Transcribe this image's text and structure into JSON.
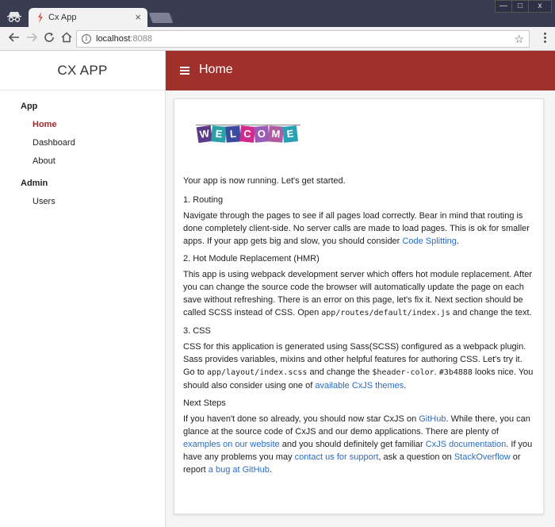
{
  "browser": {
    "tab_title": "Cx App",
    "tab_close": "×",
    "url_host": "localhost",
    "url_port": ":8088",
    "window_controls": [
      "—",
      "□",
      "x"
    ],
    "icons": [
      "incognito-icon",
      "favicon-icon",
      "back-icon",
      "forward-icon",
      "reload-icon",
      "home-icon",
      "info-icon",
      "star-icon",
      "menu-icon"
    ]
  },
  "sidebar": {
    "brand": "CX APP",
    "groups": [
      {
        "title": "App",
        "items": [
          "Home",
          "Dashboard",
          "About"
        ]
      },
      {
        "title": "Admin",
        "items": [
          "Users"
        ]
      }
    ]
  },
  "header": {
    "title": "Home"
  },
  "welcome_letters": [
    "W",
    "E",
    "L",
    "C",
    "O",
    "M",
    "E"
  ],
  "welcome_colors": [
    "#5a3a8a",
    "#2aa0a8",
    "#3a4aa0",
    "#d02a8a",
    "#9a5ab8",
    "#b05aa0",
    "#2aa0b8"
  ],
  "content": {
    "intro": "Your app is now running. Let's get started.",
    "routing": {
      "title": "1. Routing",
      "text": "Navigate through the pages to see if all pages load correctly. Bear in mind that routing is done completely client-side. No server calls are made to load pages. This is ok for smaller apps. If your app gets big and slow, you should consider ",
      "link": "Code Splitting",
      "tail": "."
    },
    "hmr": {
      "title": "2. Hot Module Replacement (HMR)",
      "text": "This app is using webpack development server which offers hot module replacement. After you can change the source code the browser will automatically update the page on each save without refreshing. There is an error on this page, let's fix it. Next section should be called SCSS instead of CSS. Open ",
      "code": "app/routes/default/index.js",
      "tail": " and change the text."
    },
    "css": {
      "title": "3. CSS",
      "text1": "CSS for this application is generated using Sass(SCSS) configured as a webpack plugin. Sass provides variables, mixins and other helpful features for authoring CSS. Let's try it. Go to ",
      "code1": "app/layout/index.scss",
      "text2": " and change the ",
      "code2": "$header-color",
      "text3": ". ",
      "code3": "#3b4888",
      "text4": " looks nice. You should also consider using one of ",
      "link": "available CxJS themes",
      "tail": "."
    },
    "next": {
      "title": "Next Steps",
      "t1": "If you haven't done so already, you should now star CxJS on ",
      "l1": "GitHub",
      "t2": ". While there, you can glance at the source code of CxJS and our demo applications. There are plenty of ",
      "l2": "examples on our website",
      "t3": " and you should definitely get familiar ",
      "l3": "CxJS documentation",
      "t4": ". If you have any problems you may ",
      "l4": "contact us for support",
      "t5": ", ask a question on ",
      "l5": "StackOverflow",
      "t6": " or report ",
      "l6": "a bug at GitHub",
      "t7": "."
    }
  }
}
